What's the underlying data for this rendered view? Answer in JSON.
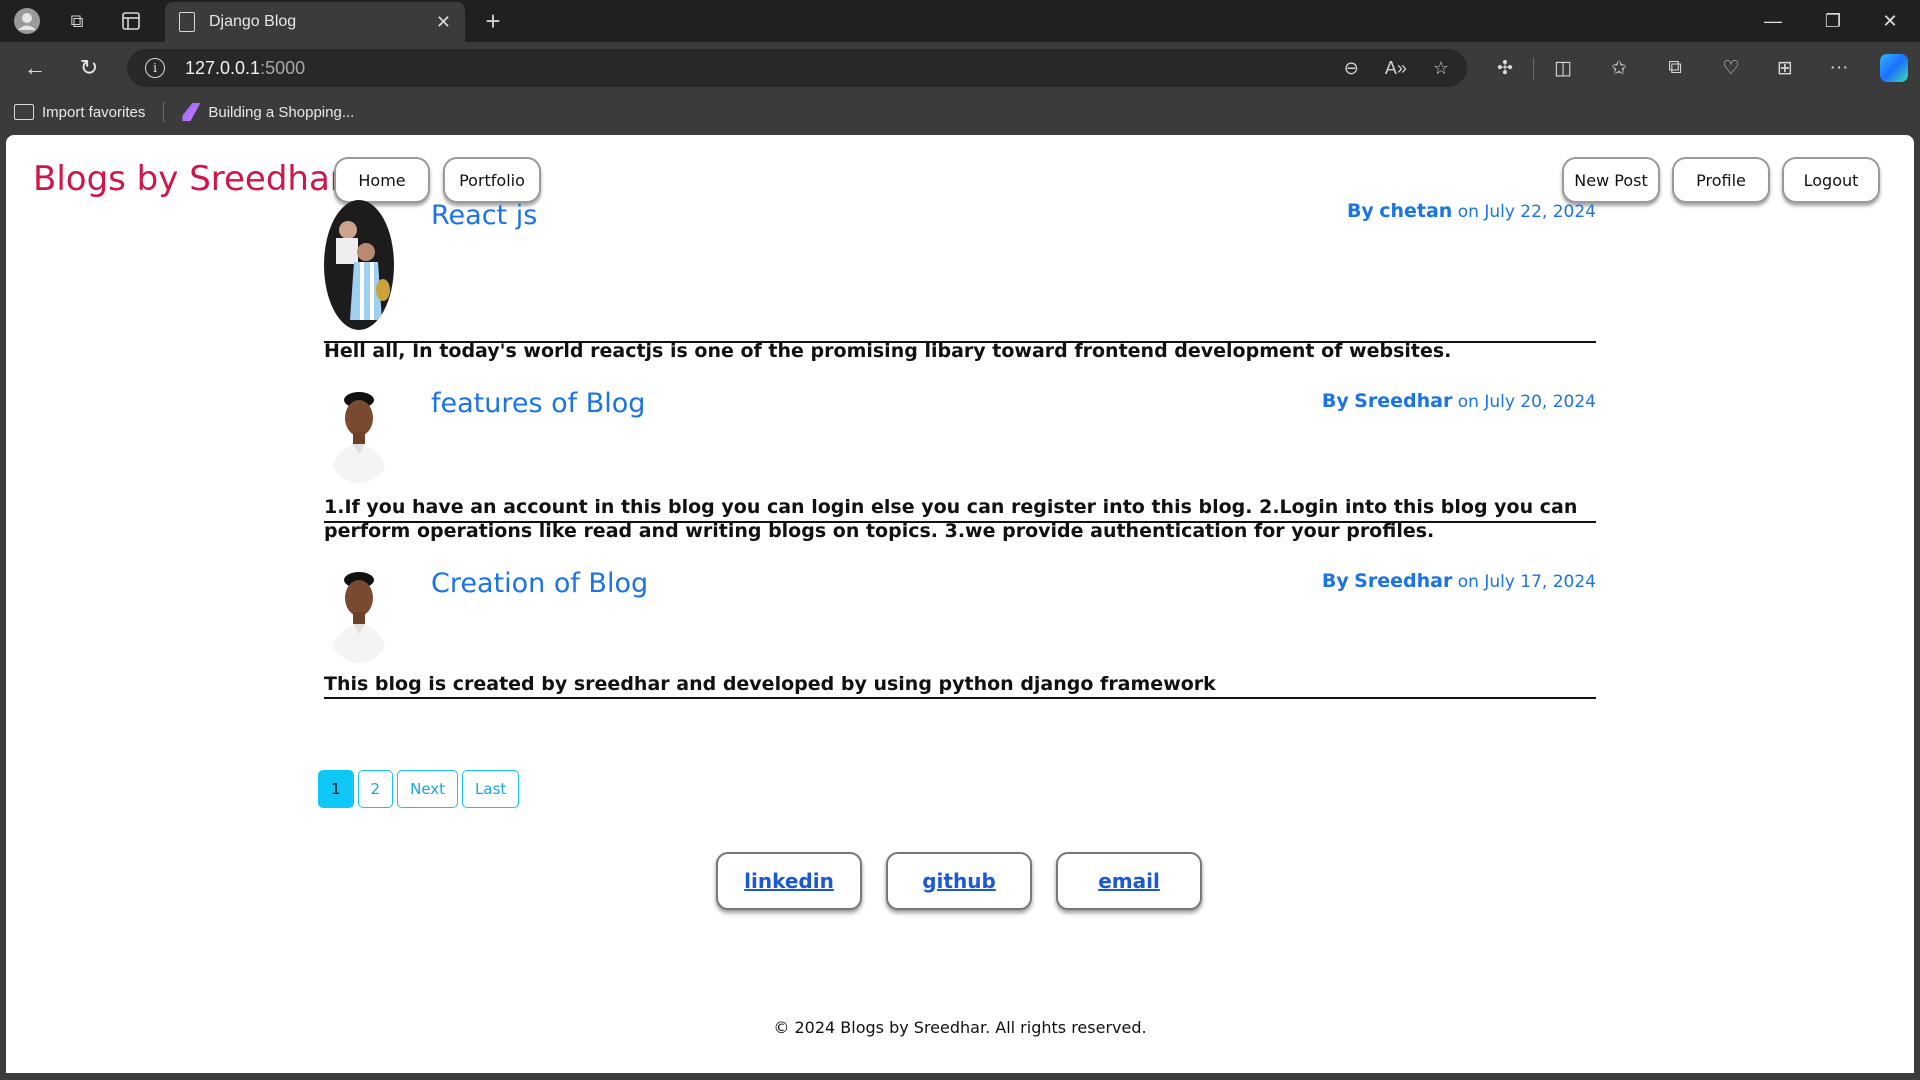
{
  "browser": {
    "tab_title": "Django Blog",
    "url_host": "127.0.0.1",
    "url_port": ":5000",
    "favorites": [
      {
        "label": "Import favorites"
      },
      {
        "label": "Building a Shopping..."
      }
    ]
  },
  "site": {
    "brand": "Blogs by Sreedhar",
    "nav_left": [
      {
        "label": "Home"
      },
      {
        "label": "Portfolio"
      }
    ],
    "nav_right": [
      {
        "label": "New Post"
      },
      {
        "label": "Profile"
      },
      {
        "label": "Logout"
      }
    ]
  },
  "posts": [
    {
      "title": "React js",
      "author_prefix": "By",
      "author": "chetan",
      "date": "on July 22, 2024",
      "body": "Hell all, In today's world reactjs is one of the promising libary toward frontend development of websites."
    },
    {
      "title": "features of Blog",
      "author_prefix": "By",
      "author": "Sreedhar",
      "date": "on July 20, 2024",
      "body": "1.If you have an account in this blog you can login else you can register into this blog. 2.Login into this blog you can perform operations like read and writing blogs on topics. 3.we provide authentication for your profiles."
    },
    {
      "title": "Creation of Blog",
      "author_prefix": "By",
      "author": "Sreedhar",
      "date": "on July 17, 2024",
      "body": "This blog is created by sreedhar and developed by using python django framework"
    }
  ],
  "pagination": {
    "pages": [
      "1",
      "2"
    ],
    "current": "1",
    "next_label": "Next",
    "last_label": "Last"
  },
  "social": [
    {
      "label": "linkedin"
    },
    {
      "label": "github"
    },
    {
      "label": "email"
    }
  ],
  "footer": "© 2024 Blogs by Sreedhar. All rights reserved.",
  "colors": {
    "brand": "#d0154a",
    "link": "#1a73e8",
    "pager_active": "#0fc8f7"
  }
}
